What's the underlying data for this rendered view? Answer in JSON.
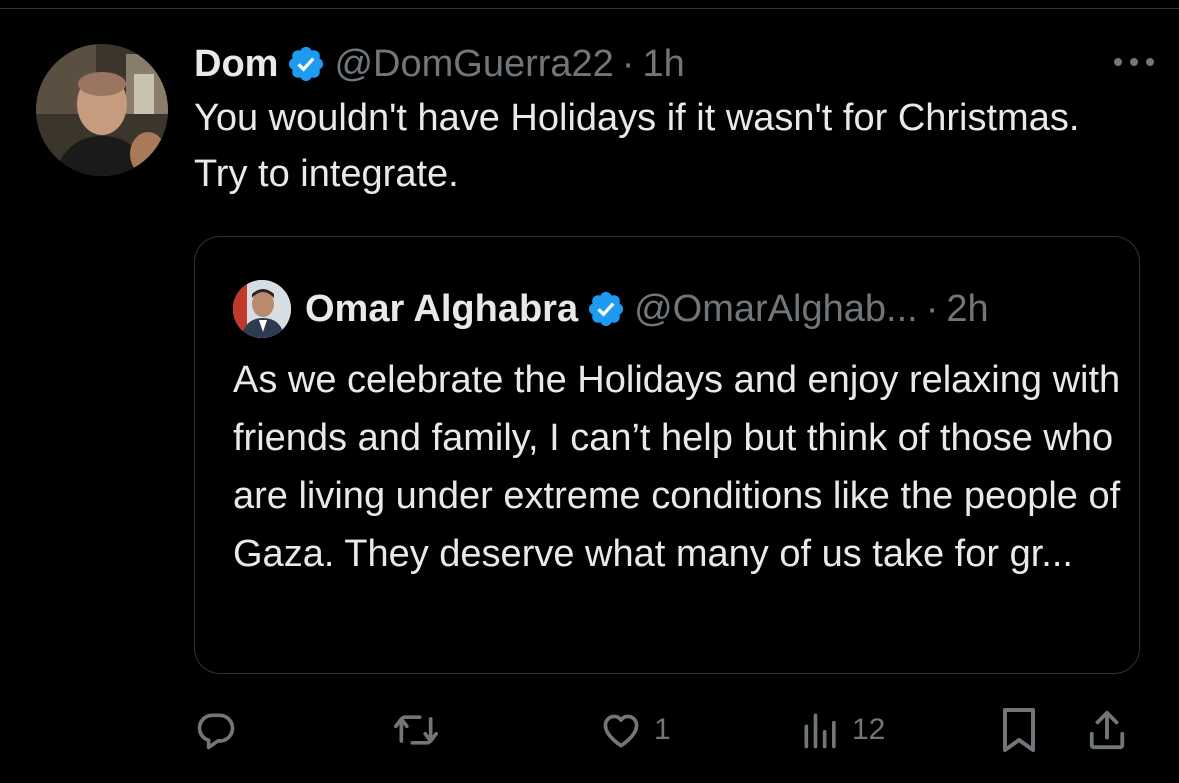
{
  "tweet": {
    "author_name": "Dom",
    "author_handle": "@DomGuerra22",
    "separator": "·",
    "time": "1h",
    "text": "You wouldn't have Holidays if it wasn't for Christmas. Try to integrate.",
    "verified": true
  },
  "quoted_tweet": {
    "author_name": "Omar Alghabra",
    "author_handle": "@OmarAlghab...",
    "separator": "·",
    "time": "2h",
    "text": "As we celebrate the Holidays and enjoy relaxing with friends and family, I can’t help but think of those who are living under extreme conditions like the people of Gaza. They deserve what many of us take for gr...",
    "verified": true
  },
  "actions": {
    "reply_count": "",
    "retweet_count": "",
    "like_count": "1",
    "views_count": "12"
  },
  "colors": {
    "background": "#000000",
    "text_primary": "#e7e9ea",
    "text_secondary": "#71767b",
    "verified_blue": "#1d9bf0",
    "border": "#2f3336"
  },
  "icons": {
    "more": "more-icon",
    "verified": "verified-badge-icon",
    "reply": "reply-icon",
    "retweet": "retweet-icon",
    "like": "heart-icon",
    "views": "views-icon",
    "bookmark": "bookmark-icon",
    "share": "share-icon"
  }
}
